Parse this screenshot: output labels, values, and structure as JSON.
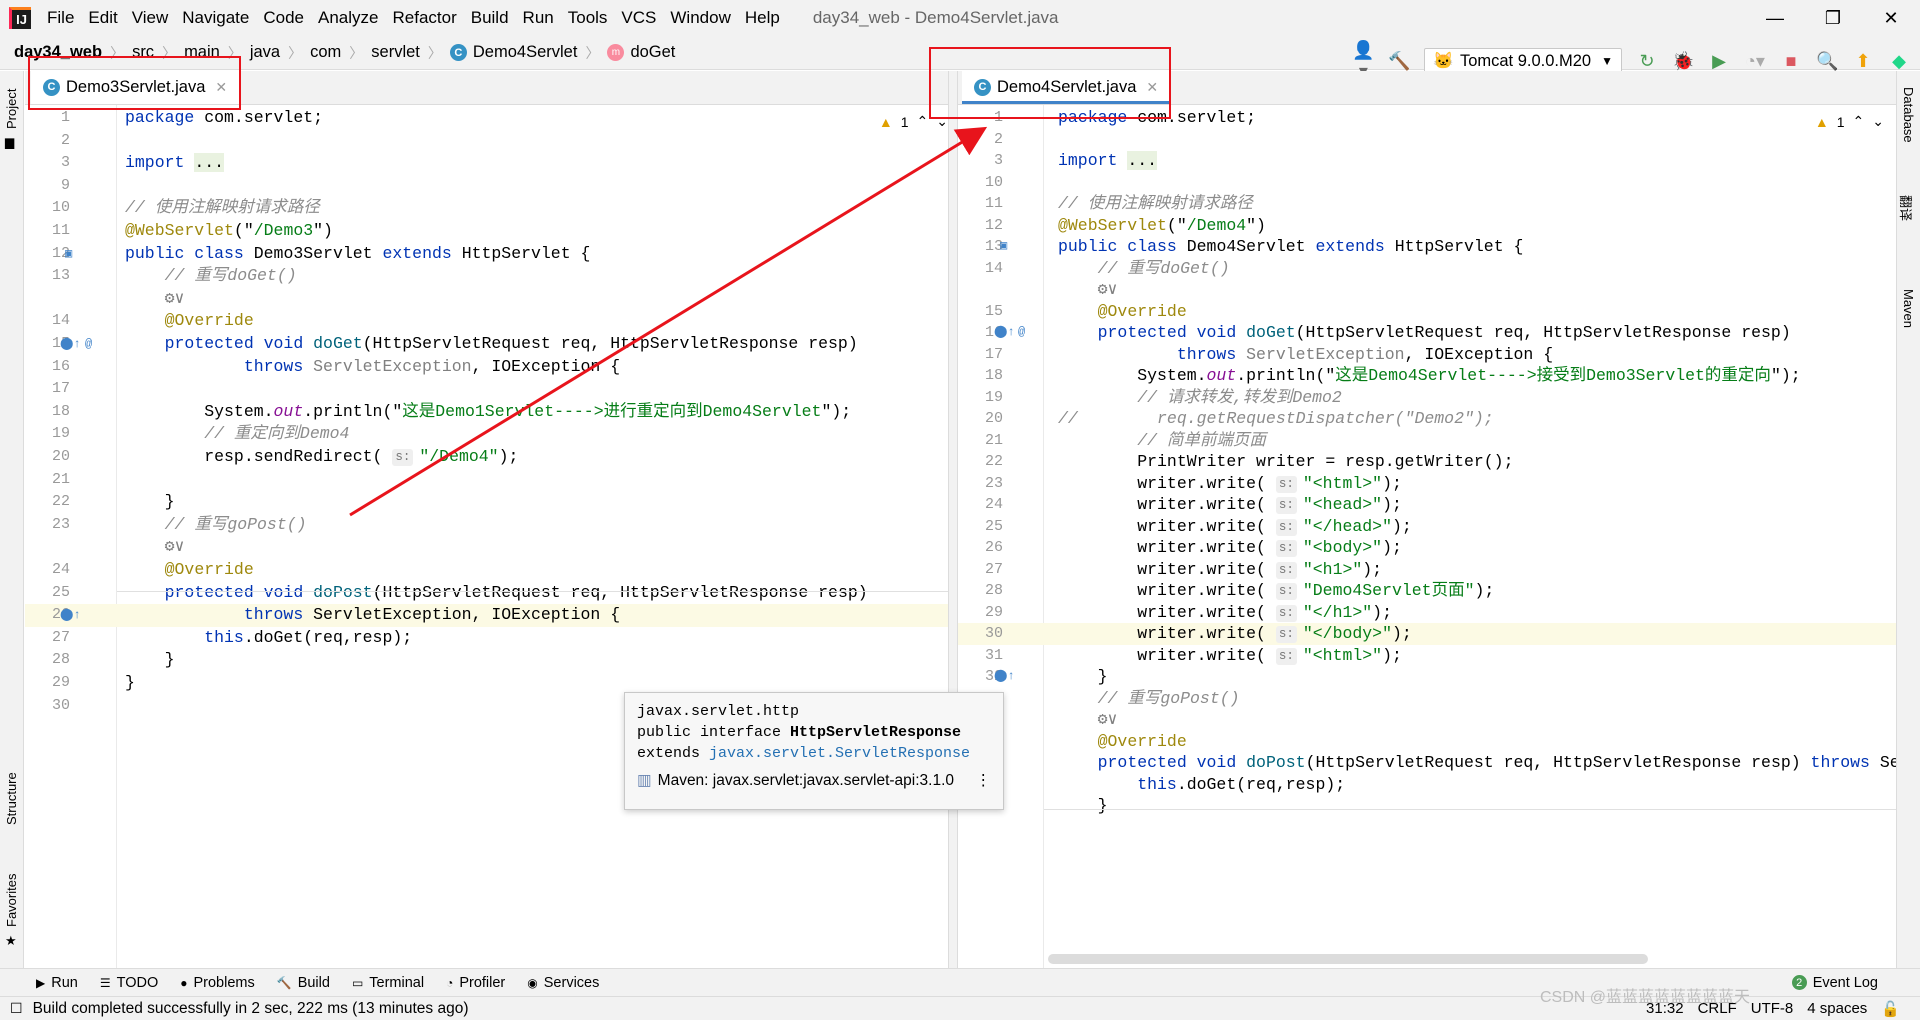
{
  "window": {
    "title": "day34_web - Demo4Servlet.java",
    "logo": "IJ"
  },
  "menu": [
    "File",
    "Edit",
    "View",
    "Navigate",
    "Code",
    "Analyze",
    "Refactor",
    "Build",
    "Run",
    "Tools",
    "VCS",
    "Window",
    "Help"
  ],
  "breadcrumb": {
    "project": "day34_web",
    "parts": [
      "src",
      "main",
      "java",
      "com",
      "servlet"
    ],
    "cls": "Demo4Servlet",
    "method": "doGet"
  },
  "toolbar": {
    "run_config": "Tomcat 9.0.0.M20"
  },
  "left_strip": {
    "project": "Project",
    "structure": "Structure",
    "favorites": "Favorites"
  },
  "right_strip": {
    "database": "Database",
    "translate": "翻译",
    "maven": "Maven"
  },
  "left_editor": {
    "tab": "Demo3Servlet.java",
    "warnings": "1",
    "lines": [
      {
        "n": "1",
        "tokens": [
          [
            "kw",
            "package "
          ],
          [
            "",
            "com.servlet;"
          ]
        ]
      },
      {
        "n": "2",
        "tokens": []
      },
      {
        "n": "3",
        "tokens": [
          [
            "kw",
            "import "
          ],
          [
            "fold",
            "..."
          ]
        ]
      },
      {
        "n": "9",
        "tokens": []
      },
      {
        "n": "10",
        "tokens": [
          [
            "cmt",
            "// 使用注解映射请求路径"
          ]
        ]
      },
      {
        "n": "11",
        "tokens": [
          [
            "ann",
            "@WebServlet"
          ],
          [
            "",
            "(\""
          ],
          [
            "str",
            "/Demo3"
          ],
          [
            "",
            "\")"
          ]
        ]
      },
      {
        "n": "12",
        "tokens": [
          [
            "kw",
            "public class "
          ],
          [
            "",
            "Demo3Servlet "
          ],
          [
            "kw",
            "extends "
          ],
          [
            "",
            "HttpServlet {"
          ]
        ]
      },
      {
        "n": "13",
        "tokens": [
          [
            "gray",
            "    "
          ],
          [
            "cmt",
            "// 重写doGet()"
          ]
        ]
      },
      {
        "n": "",
        "tokens": [
          [
            "gray",
            "    "
          ],
          [
            "gray",
            "⚙∨"
          ]
        ]
      },
      {
        "n": "14",
        "tokens": [
          [
            "gray",
            "    "
          ],
          [
            "ann",
            "@Override"
          ]
        ]
      },
      {
        "n": "15",
        "tokens": [
          [
            "gray",
            "    "
          ],
          [
            "kw",
            "protected void "
          ],
          [
            "fn",
            "doGet"
          ],
          [
            "",
            "(HttpServletRequest req, HttpServletResponse resp)"
          ]
        ]
      },
      {
        "n": "16",
        "tokens": [
          [
            "gray",
            "            "
          ],
          [
            "kw",
            "throws "
          ],
          [
            "gray",
            "ServletException"
          ],
          [
            "",
            ", IOException {"
          ]
        ]
      },
      {
        "n": "17",
        "tokens": []
      },
      {
        "n": "18",
        "tokens": [
          [
            "gray",
            "        "
          ],
          [
            "",
            "System."
          ],
          [
            "fld",
            "out"
          ],
          [
            "",
            ".println(\""
          ],
          [
            "str",
            "这是Demo1Servlet---->进行重定向到Demo4Servlet"
          ],
          [
            "",
            "\");"
          ]
        ]
      },
      {
        "n": "19",
        "tokens": [
          [
            "gray",
            "        "
          ],
          [
            "cmt",
            "// 重定向到Demo4"
          ]
        ]
      },
      {
        "n": "20",
        "tokens": [
          [
            "gray",
            "        "
          ],
          [
            "",
            "resp.sendRedirect( "
          ],
          [
            "hint",
            "s:"
          ],
          [
            "str",
            "\"/Demo4\""
          ],
          [
            "",
            ");"
          ]
        ]
      },
      {
        "n": "21",
        "tokens": []
      },
      {
        "n": "22",
        "tokens": [
          [
            "gray",
            "    "
          ],
          [
            "",
            "}"
          ]
        ]
      },
      {
        "n": "23",
        "tokens": [
          [
            "gray",
            "    "
          ],
          [
            "cmt",
            "// 重写goPost()"
          ]
        ]
      },
      {
        "n": "",
        "tokens": [
          [
            "gray",
            "    "
          ],
          [
            "gray",
            "⚙∨"
          ]
        ]
      },
      {
        "n": "24",
        "tokens": [
          [
            "gray",
            "    "
          ],
          [
            "ann",
            "@Override"
          ]
        ]
      },
      {
        "n": "25",
        "tokens": [
          [
            "gray",
            "    "
          ],
          [
            "kw",
            "protected void "
          ],
          [
            "fn",
            "doPost"
          ],
          [
            "",
            "(HttpServletRequest req, HttpServletResponse resp)"
          ]
        ]
      },
      {
        "n": "26",
        "tokens": [
          [
            "gray",
            "            "
          ],
          [
            "kw",
            "throws "
          ],
          [
            "",
            "ServletException, IOException {"
          ]
        ]
      },
      {
        "n": "27",
        "tokens": [
          [
            "gray",
            "        "
          ],
          [
            "kw",
            "this"
          ],
          [
            "",
            ".doGet(req,resp);"
          ]
        ]
      },
      {
        "n": "28",
        "tokens": [
          [
            "gray",
            "    "
          ],
          [
            "",
            "}"
          ]
        ]
      },
      {
        "n": "29",
        "tokens": [
          [
            "",
            "}"
          ]
        ]
      },
      {
        "n": "30",
        "tokens": []
      }
    ]
  },
  "right_editor": {
    "tab": "Demo4Servlet.java",
    "warnings": "1",
    "lines": [
      {
        "n": "1",
        "tokens": [
          [
            "kw",
            "package "
          ],
          [
            "",
            "com.servlet;"
          ]
        ]
      },
      {
        "n": "2",
        "tokens": []
      },
      {
        "n": "3",
        "tokens": [
          [
            "kw",
            "import "
          ],
          [
            "fold",
            "..."
          ]
        ]
      },
      {
        "n": "10",
        "tokens": []
      },
      {
        "n": "11",
        "tokens": [
          [
            "cmt",
            "// 使用注解映射请求路径"
          ]
        ]
      },
      {
        "n": "12",
        "tokens": [
          [
            "ann",
            "@WebServlet"
          ],
          [
            "",
            "(\""
          ],
          [
            "str",
            "/Demo4"
          ],
          [
            "",
            "\")"
          ]
        ]
      },
      {
        "n": "13",
        "tokens": [
          [
            "kw",
            "public class "
          ],
          [
            "",
            "Demo4Servlet "
          ],
          [
            "kw",
            "extends "
          ],
          [
            "",
            "HttpServlet {"
          ]
        ]
      },
      {
        "n": "14",
        "tokens": [
          [
            "gray",
            "    "
          ],
          [
            "cmt",
            "// 重写doGet()"
          ]
        ]
      },
      {
        "n": "",
        "tokens": [
          [
            "gray",
            "    "
          ],
          [
            "gray",
            "⚙∨"
          ]
        ]
      },
      {
        "n": "15",
        "tokens": [
          [
            "gray",
            "    "
          ],
          [
            "ann",
            "@Override"
          ]
        ]
      },
      {
        "n": "16",
        "tokens": [
          [
            "gray",
            "    "
          ],
          [
            "kw",
            "protected void "
          ],
          [
            "fn",
            "doGet"
          ],
          [
            "",
            "(HttpServletRequest req, HttpServletResponse resp)"
          ]
        ]
      },
      {
        "n": "17",
        "tokens": [
          [
            "gray",
            "            "
          ],
          [
            "kw",
            "throws "
          ],
          [
            "gray",
            "ServletException"
          ],
          [
            "",
            ", IOException {"
          ]
        ]
      },
      {
        "n": "18",
        "tokens": [
          [
            "gray",
            "        "
          ],
          [
            "",
            "System."
          ],
          [
            "fld",
            "out"
          ],
          [
            "",
            ".println(\""
          ],
          [
            "str",
            "这是Demo4Servlet---->接受到Demo3Servlet的重定向"
          ],
          [
            "",
            "\");"
          ]
        ]
      },
      {
        "n": "19",
        "tokens": [
          [
            "gray",
            "        "
          ],
          [
            "cmt",
            "// 请求转发,转发到Demo2"
          ]
        ]
      },
      {
        "n": "20",
        "tokens": [
          [
            "cmt",
            "//        req.getRequestDispatcher(\"Demo2\");"
          ]
        ]
      },
      {
        "n": "21",
        "tokens": [
          [
            "gray",
            "        "
          ],
          [
            "cmt",
            "// 简单前端页面"
          ]
        ]
      },
      {
        "n": "22",
        "tokens": [
          [
            "gray",
            "        "
          ],
          [
            "",
            "PrintWriter writer = resp.getWriter();"
          ]
        ]
      },
      {
        "n": "23",
        "tokens": [
          [
            "gray",
            "        "
          ],
          [
            "",
            "writer.write( "
          ],
          [
            "hint",
            "s:"
          ],
          [
            "str",
            "\"<html>\""
          ],
          [
            "",
            ");"
          ]
        ]
      },
      {
        "n": "24",
        "tokens": [
          [
            "gray",
            "        "
          ],
          [
            "",
            "writer.write( "
          ],
          [
            "hint",
            "s:"
          ],
          [
            "str",
            "\"<head>\""
          ],
          [
            "",
            ");"
          ]
        ]
      },
      {
        "n": "25",
        "tokens": [
          [
            "gray",
            "        "
          ],
          [
            "",
            "writer.write( "
          ],
          [
            "hint",
            "s:"
          ],
          [
            "str",
            "\"</head>\""
          ],
          [
            "",
            ");"
          ]
        ]
      },
      {
        "n": "26",
        "tokens": [
          [
            "gray",
            "        "
          ],
          [
            "",
            "writer.write( "
          ],
          [
            "hint",
            "s:"
          ],
          [
            "str",
            "\"<body>\""
          ],
          [
            "",
            ");"
          ]
        ]
      },
      {
        "n": "27",
        "tokens": [
          [
            "gray",
            "        "
          ],
          [
            "",
            "writer.write( "
          ],
          [
            "hint",
            "s:"
          ],
          [
            "str",
            "\"<h1>\""
          ],
          [
            "",
            ");"
          ]
        ]
      },
      {
        "n": "28",
        "tokens": [
          [
            "gray",
            "        "
          ],
          [
            "",
            "writer.write( "
          ],
          [
            "hint",
            "s:"
          ],
          [
            "str",
            "\"Demo4Servlet页面\""
          ],
          [
            "",
            ");"
          ]
        ]
      },
      {
        "n": "29",
        "tokens": [
          [
            "gray",
            "        "
          ],
          [
            "",
            "writer.write( "
          ],
          [
            "hint",
            "s:"
          ],
          [
            "str",
            "\"</h1>\""
          ],
          [
            "",
            ");"
          ]
        ]
      },
      {
        "n": "30",
        "tokens": [
          [
            "gray",
            "        "
          ],
          [
            "",
            "writer.write( "
          ],
          [
            "hint",
            "s:"
          ],
          [
            "str",
            "\"</body>\""
          ],
          [
            "",
            ");"
          ]
        ]
      },
      {
        "n": "31",
        "tokens": [
          [
            "gray",
            "        "
          ],
          [
            "",
            "writer.write( "
          ],
          [
            "hint",
            "s:"
          ],
          [
            "str",
            "\"<html>\""
          ],
          [
            "",
            ");"
          ]
        ]
      },
      {
        "n": "32",
        "tokens": [
          [
            "gray",
            "    "
          ],
          [
            "",
            "}"
          ]
        ]
      },
      {
        "n": "33",
        "tokens": [
          [
            "gray",
            "    "
          ],
          [
            "cmt",
            "// 重写goPost()"
          ]
        ]
      },
      {
        "n": "",
        "tokens": [
          [
            "gray",
            "    "
          ],
          [
            "gray",
            "⚙∨"
          ]
        ]
      },
      {
        "n": "34",
        "tokens": [
          [
            "gray",
            "    "
          ],
          [
            "ann",
            "@Override"
          ]
        ]
      },
      {
        "n": "35",
        "tokens": [
          [
            "gray",
            "    "
          ],
          [
            "kw",
            "protected void "
          ],
          [
            "fn",
            "doPost"
          ],
          [
            "",
            "(HttpServletRequest req, HttpServletResponse resp) "
          ],
          [
            "kw",
            "throws "
          ],
          [
            "",
            "ServletExce"
          ]
        ]
      },
      {
        "n": "36",
        "tokens": [
          [
            "gray",
            "        "
          ],
          [
            "kw",
            "this"
          ],
          [
            "",
            ".doGet(req,resp);"
          ]
        ]
      },
      {
        "n": "37",
        "tokens": [
          [
            "gray",
            "    "
          ],
          [
            "",
            "}"
          ]
        ]
      }
    ]
  },
  "popup": {
    "package": "javax.servlet.http",
    "decl_prefix": "public interface ",
    "decl_name": "HttpServletResponse",
    "extends_kw": "extends ",
    "extends_link": "javax.servlet.ServletResponse",
    "maven": "Maven: javax.servlet:javax.servlet-api:3.1.0"
  },
  "bottom_tools": [
    "Run",
    "TODO",
    "Problems",
    "Build",
    "Terminal",
    "Profiler",
    "Services"
  ],
  "event_log": "Event Log",
  "event_count": "2",
  "status": {
    "message": "Build completed successfully in 2 sec, 222 ms (13 minutes ago)",
    "position": "31:32",
    "line_sep": "CRLF",
    "encoding": "UTF-8",
    "indent": "4 spaces"
  },
  "watermark": "CSDN @蓝蓝蓝蓝蓝蓝蓝蓝天"
}
